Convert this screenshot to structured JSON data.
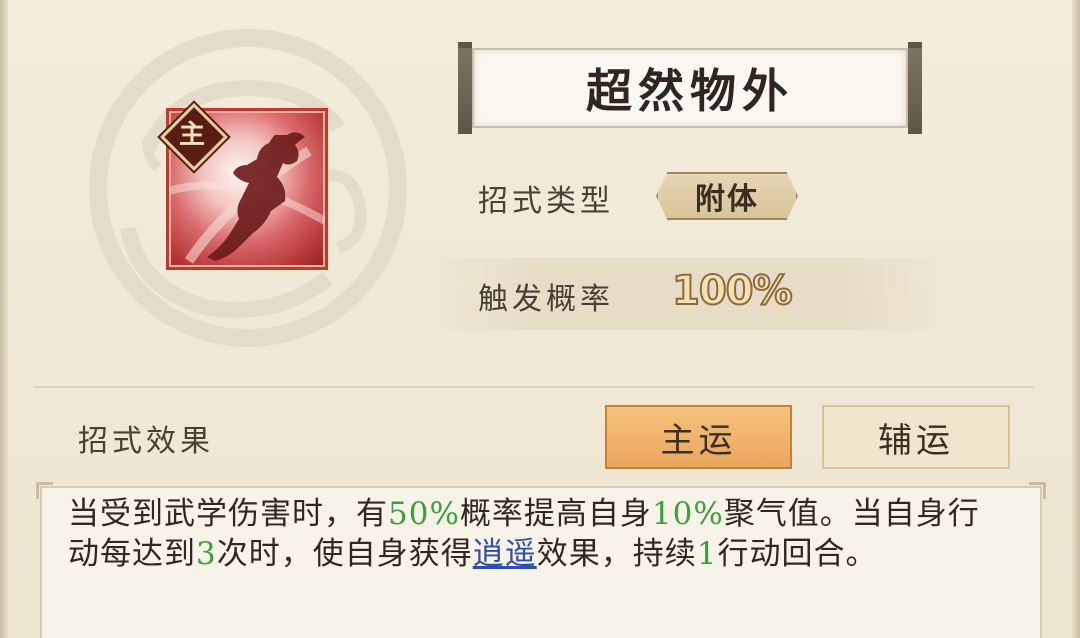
{
  "skill": {
    "name": "超然物外",
    "badge": "主",
    "icon": "fighter-silhouette-icon"
  },
  "info": {
    "type_label": "招式类型",
    "type_value": "附体",
    "trigger_label": "触发概率",
    "trigger_value": "100%"
  },
  "effect": {
    "label": "招式效果",
    "tabs": [
      {
        "label": "主运",
        "active": true
      },
      {
        "label": "辅运",
        "active": false
      }
    ],
    "desc": {
      "p1": "当受到武学伤害时，有",
      "v1": "50%",
      "p2": "概率提高自身",
      "v2": "10%",
      "p3": "聚气值。当自身行动每达到",
      "v3": "3",
      "p4": "次时，使自身获得",
      "link": "逍遥",
      "p5": "效果，持续",
      "v4": "1",
      "p6": "行动回合。"
    }
  },
  "colors": {
    "highlight": "#3aa03a",
    "link": "#2c4fa8",
    "active_tab": "#eaa65d",
    "icon_frame": "#c2382a"
  }
}
